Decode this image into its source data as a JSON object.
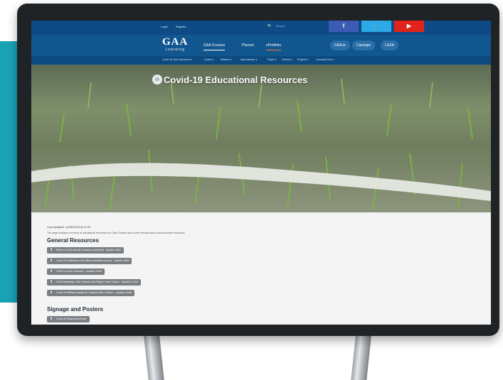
{
  "top_links": [
    "Login",
    "Register"
  ],
  "search": {
    "label": "Search"
  },
  "social": {
    "facebook": "f",
    "twitter": "🐦",
    "youtube": "▶"
  },
  "logo": {
    "mark": "GAA",
    "subtitle": "Learning"
  },
  "nav": {
    "items": [
      "GAA Courses",
      "Planner",
      "ePortfolio"
    ],
    "pills": [
      "GAA.ie",
      "Camogie",
      "LGFA"
    ]
  },
  "subnav": [
    "Covid-19 Club Education ▾",
    "Coach ▾",
    "Referee ▾",
    "Administrator ▾",
    "Player ▾",
    "Games ▾",
    "Projects ▾",
    "Learning Zone ▾"
  ],
  "hero": {
    "title": "Covid-19 Educational Resources",
    "badge": "⊖"
  },
  "content": {
    "updated": "Last Updated: 14/06/2020 at 11:20",
    "intro": "This page contains a number of educational resources for Clubs. Please click on the relevant links to access these resources.",
    "general_heading": "General Resources",
    "resources": [
      "Return to GAA Activity Guidance (Updated) - Update 15/06",
      "Covid-19 Guidelines Club Officer Induction Course - Update 15/06",
      "GAA Pre-Entry Checklist - Updated 15/06",
      "GAA Reopening: Club Referee and Players Team Course - Updated 11/06",
      "Covid-19 Welfare Update for Coaches with Children - Updated 15/06"
    ],
    "signage_heading": "Signage and Posters",
    "signage_items": [
      "Covid-19 Reopening Poster"
    ]
  },
  "colors": {
    "topbar": "#0e4a86",
    "nav": "#12568f",
    "accent_teal": "#1aa2b5",
    "button_grey": "#7a7f84"
  }
}
